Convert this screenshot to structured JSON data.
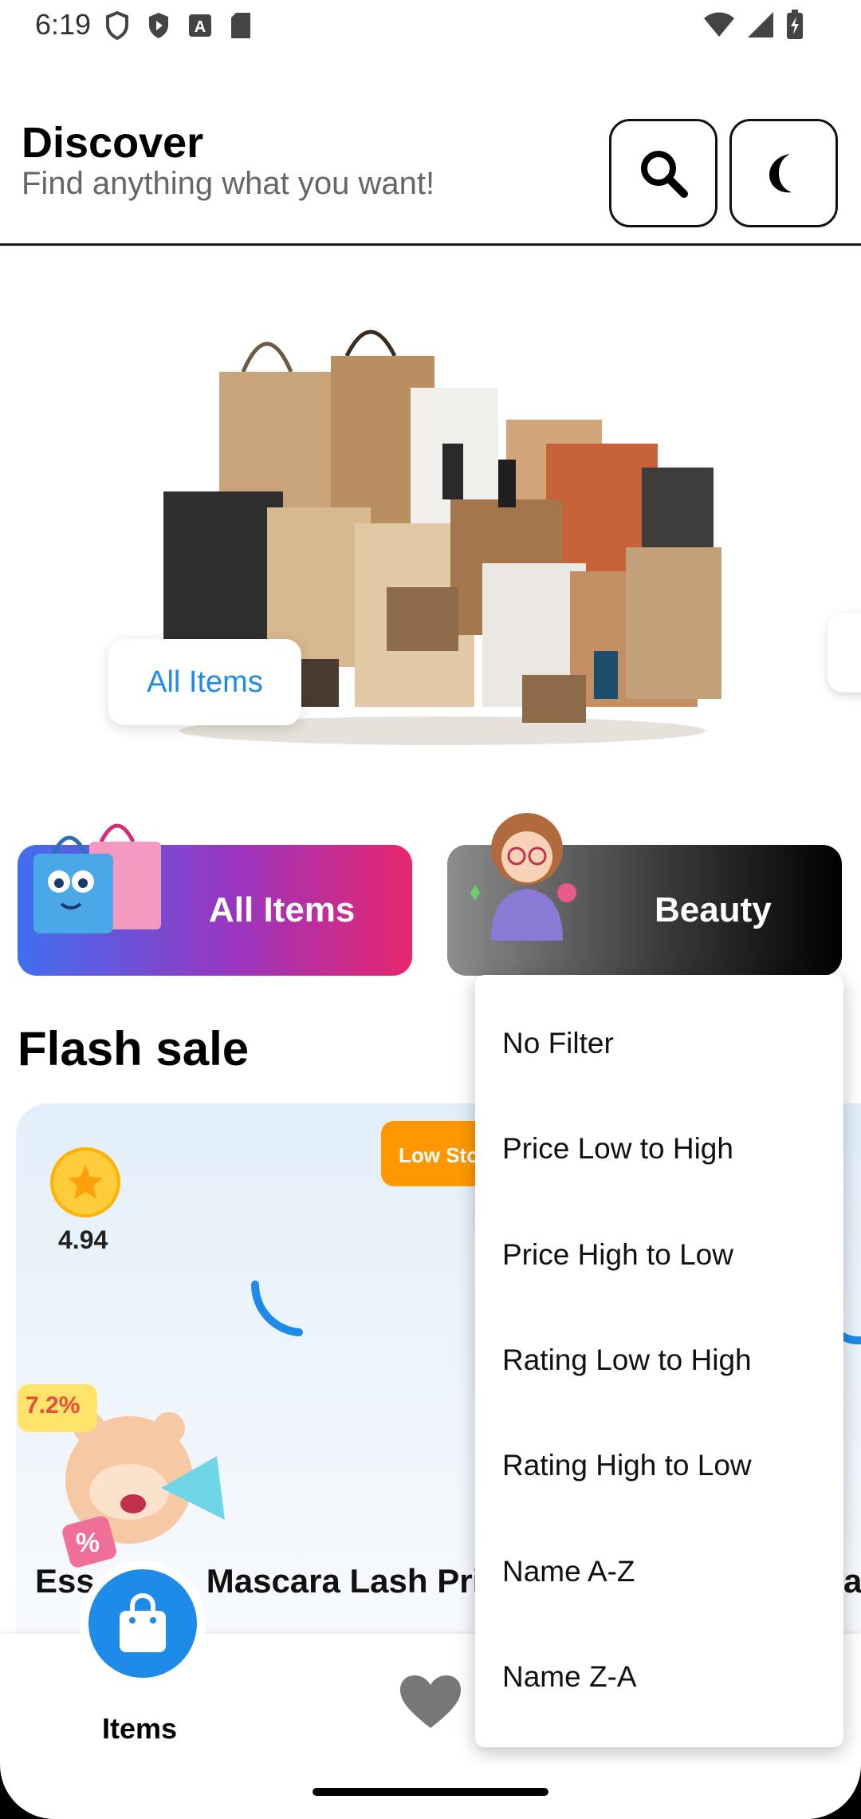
{
  "status_bar": {
    "time": "6:19"
  },
  "header": {
    "title": "Discover",
    "subtitle": "Find anything what you want!"
  },
  "hero": {
    "button_label": "All Items"
  },
  "categories": [
    {
      "label": "All Items"
    },
    {
      "label": "Beauty"
    }
  ],
  "flash_sale": {
    "title": "Flash sale",
    "product": {
      "rating": "4.94",
      "badge": "Low Sto",
      "discount": "7.2%",
      "name_left": "Ess",
      "name_right": "Mascara Lash Prin",
      "next_name": "a"
    }
  },
  "bottom_nav": {
    "items_label": "Items"
  },
  "sort_menu": {
    "options": [
      "No Filter",
      "Price Low to High",
      "Price High to Low",
      "Rating Low to High",
      "Rating High to Low",
      "Name A-Z",
      "Name Z-A"
    ]
  },
  "colors": {
    "accent": "#1f8be8",
    "badge": "#ff9800"
  }
}
